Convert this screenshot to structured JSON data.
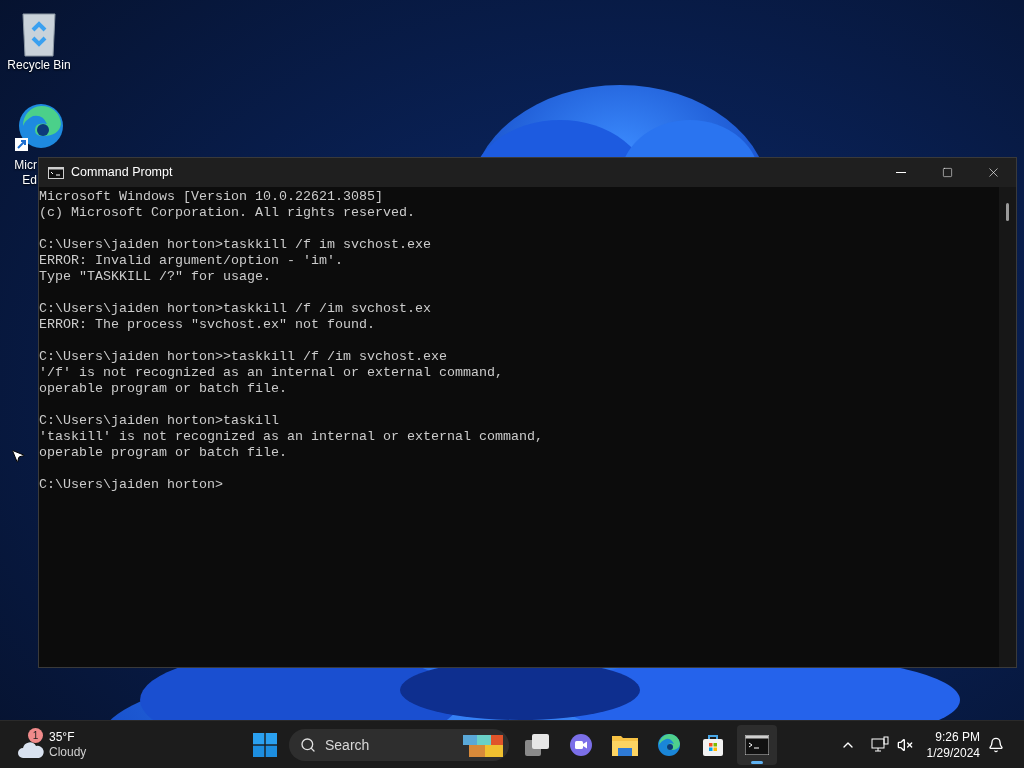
{
  "desktop": {
    "icons": [
      {
        "kind": "recycle-bin",
        "label_lines": [
          "Recycle Bin"
        ]
      },
      {
        "kind": "edge",
        "label_lines": [
          "Micr",
          "Ed"
        ]
      }
    ]
  },
  "window": {
    "title": "Command Prompt",
    "blocks": [
      [
        "Microsoft Windows [Version 10.0.22621.3085]",
        "(c) Microsoft Corporation. All rights reserved."
      ],
      [
        "C:\\Users\\jaiden horton>taskkill /f im svchost.exe",
        "ERROR: Invalid argument/option - 'im'.",
        "Type \"TASKKILL /?\" for usage."
      ],
      [
        "C:\\Users\\jaiden horton>taskkill /f /im svchost.ex",
        "ERROR: The process \"svchost.ex\" not found."
      ],
      [
        "C:\\Users\\jaiden horton>>taskkill /f /im svchost.exe",
        "'/f' is not recognized as an internal or external command,",
        "operable program or batch file."
      ],
      [
        "C:\\Users\\jaiden horton>taskill",
        "'taskill' is not recognized as an internal or external command,",
        "operable program or batch file."
      ],
      [
        "C:\\Users\\jaiden horton>"
      ]
    ]
  },
  "taskbar": {
    "weather": {
      "badge": "1",
      "temperature": "35°F",
      "condition": "Cloudy"
    },
    "search": {
      "placeholder": "Search"
    },
    "apps": [
      {
        "kind": "task-view",
        "active": false
      },
      {
        "kind": "chat",
        "active": false
      },
      {
        "kind": "folder",
        "active": false
      },
      {
        "kind": "edge",
        "active": false
      },
      {
        "kind": "store",
        "active": false
      },
      {
        "kind": "terminal",
        "active": true
      }
    ],
    "clock": {
      "time": "9:26 PM",
      "date": "1/29/2024"
    }
  }
}
